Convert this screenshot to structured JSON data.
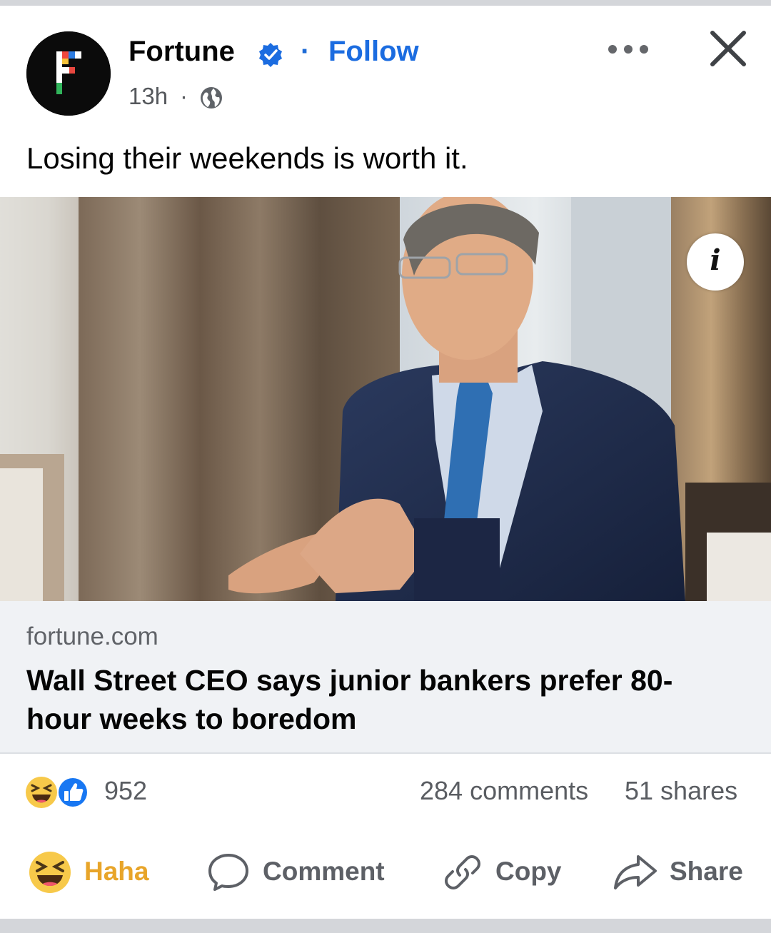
{
  "post": {
    "page_name": "Fortune",
    "separator": "·",
    "follow_label": "Follow",
    "timestamp": "13h",
    "meta_separator": "·",
    "caption": "Losing their weekends is worth it.",
    "icons": {
      "avatar": "fortune-logo",
      "verified": "verified-badge-icon",
      "audience": "globe-icon",
      "more": "more-options-icon",
      "close": "close-icon",
      "info": "info-icon"
    }
  },
  "link_preview": {
    "domain": "fortune.com",
    "headline": "Wall Street CEO says junior bankers prefer 80-hour weeks to boredom"
  },
  "engagement": {
    "reaction_icons": [
      "haha-reaction-icon",
      "like-reaction-icon"
    ],
    "reaction_count": "952",
    "comments": "284 comments",
    "shares": "51 shares"
  },
  "actions": {
    "haha": "Haha",
    "comment": "Comment",
    "copy": "Copy",
    "share": "Share"
  },
  "colors": {
    "accent_blue": "#1b6ce0",
    "haha_yellow": "#f7c94a",
    "text_secondary": "#5d6066",
    "link_bg": "#f0f2f5"
  }
}
